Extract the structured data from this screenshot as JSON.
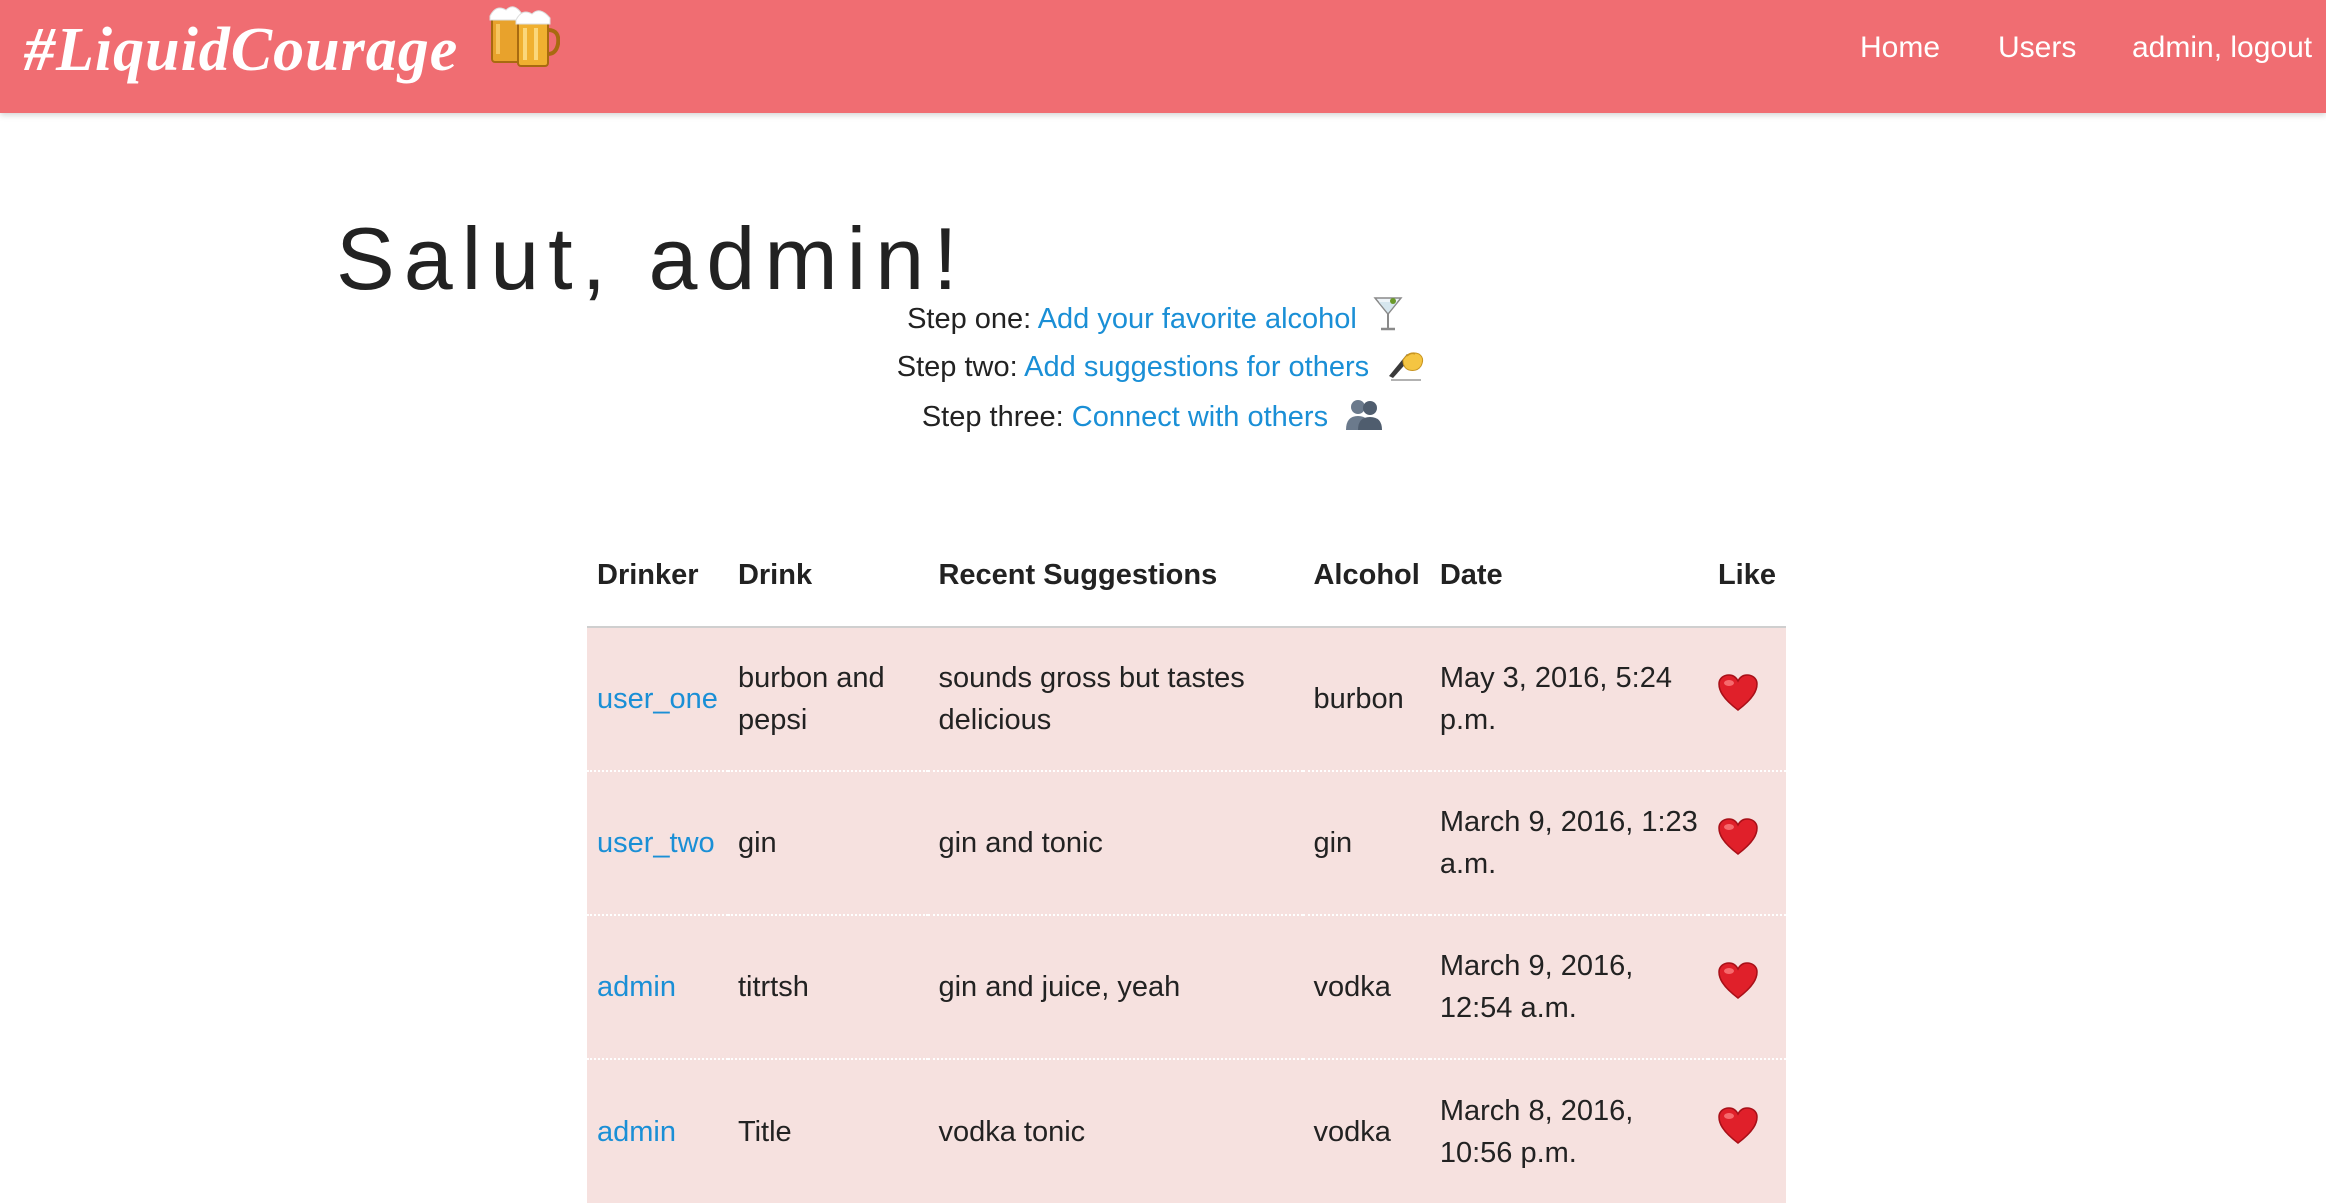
{
  "navbar": {
    "brand": "#LiquidCourage",
    "brand_icon": "beer-mugs-icon",
    "background": "#f06d72",
    "links": {
      "home": "Home",
      "users": "Users",
      "logout": "admin, logout"
    }
  },
  "greeting": "Salut, admin!",
  "steps": [
    {
      "prefix": "Step one:",
      "link": "Add your favorite alcohol",
      "icon": "cocktail-glass-icon"
    },
    {
      "prefix": "Step two:",
      "link": "Add suggestions for others",
      "icon": "writing-hand-icon"
    },
    {
      "prefix": "Step three:",
      "link": "Connect with others",
      "icon": "busts-icon"
    }
  ],
  "table": {
    "headers": [
      "Drinker",
      "Drink",
      "Recent Suggestions",
      "Alcohol",
      "Date",
      "Like"
    ],
    "rows": [
      {
        "drinker": "user_one",
        "drink": "burbon and pepsi",
        "suggestion": "sounds gross but tastes delicious",
        "alcohol": "burbon",
        "date": "May 3, 2016, 5:24 p.m.",
        "like_icon": "heart-icon"
      },
      {
        "drinker": "user_two",
        "drink": "gin",
        "suggestion": "gin and tonic",
        "alcohol": "gin",
        "date": "March 9, 2016, 1:23 a.m.",
        "like_icon": "heart-icon"
      },
      {
        "drinker": "admin",
        "drink": "titrtsh",
        "suggestion": "gin and juice, yeah",
        "alcohol": "vodka",
        "date": "March 9, 2016, 12:54 a.m.",
        "like_icon": "heart-icon"
      },
      {
        "drinker": "admin",
        "drink": "Title",
        "suggestion": "vodka tonic",
        "alcohol": "vodka",
        "date": "March 8, 2016, 10:56 p.m.",
        "like_icon": "heart-icon"
      }
    ]
  },
  "colors": {
    "accent": "#f06d72",
    "link": "#1a8fd6",
    "row_background": "#f6e1df",
    "heart": "#e0202a"
  }
}
